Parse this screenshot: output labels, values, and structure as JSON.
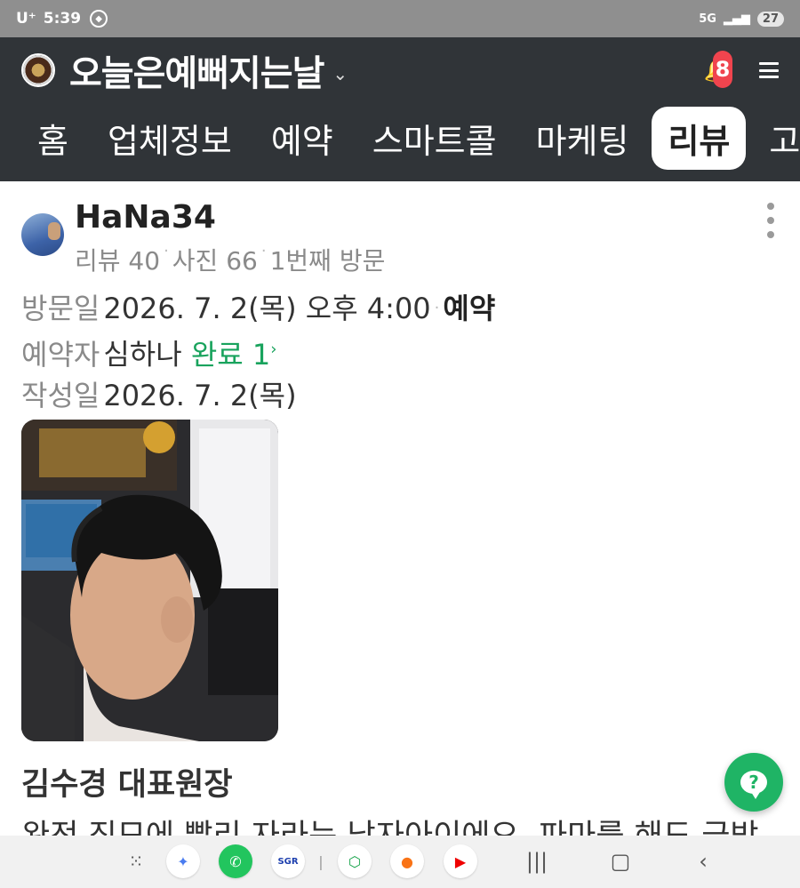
{
  "status_bar": {
    "carrier": "U⁺",
    "time": "5:39",
    "network": "5G",
    "battery": "27"
  },
  "header": {
    "shop_name": "오늘은예뻐지는날",
    "notification_count": "8",
    "icons": [
      "logo-icon",
      "chevron-down-icon",
      "bell-icon",
      "menu-icon"
    ]
  },
  "tabs": [
    {
      "label": "홈",
      "active": false
    },
    {
      "label": "업체정보",
      "active": false
    },
    {
      "label": "예약",
      "active": false
    },
    {
      "label": "스마트콜",
      "active": false
    },
    {
      "label": "마케팅",
      "active": false
    },
    {
      "label": "리뷰",
      "active": true
    },
    {
      "label": "고객",
      "active": false
    }
  ],
  "review": {
    "username": "HaNa34",
    "stats": {
      "reviews": "리뷰 40",
      "photos": "사진 66",
      "visits": "1번째 방문"
    },
    "visit_date_label": "방문일",
    "visit_date": "2026. 7. 2(목) 오후 4:00",
    "visit_type": "예약",
    "booker_label": "예약자",
    "booker_name": "심하나",
    "booker_status": "완료 1",
    "written_date_label": "작성일",
    "written_date": "2026. 7. 2(목)",
    "staff_name": "김수경 대표원장",
    "text": "완전 직모에 빨리 자라는 남자아이에요. 파마를 해도 금방"
  },
  "colors": {
    "header_bg": "#303438",
    "accent_green": "#19a35d",
    "help_button": "#1fb465",
    "badge_red": "#f0444e"
  },
  "nav_bar": {
    "apps": [
      "gemini-icon",
      "phone-icon",
      "sgr-icon",
      "shield-app-icon",
      "carrot-icon",
      "youtube-icon"
    ]
  }
}
